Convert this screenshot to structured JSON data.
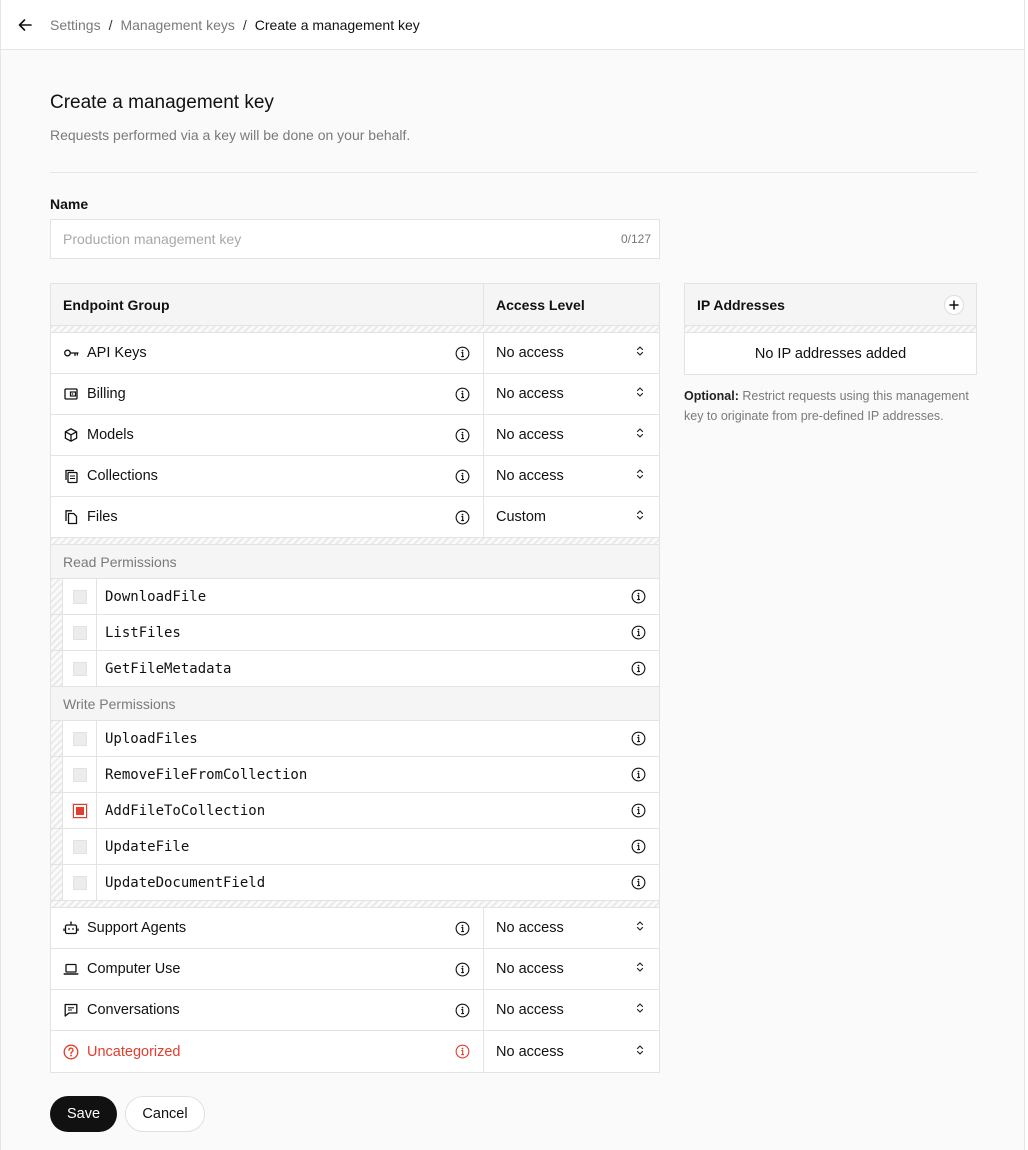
{
  "breadcrumb": {
    "items": [
      "Settings",
      "Management keys",
      "Create a management key"
    ],
    "separator": "/"
  },
  "page": {
    "title": "Create a management key",
    "subtitle": "Requests performed via a key will be done on your behalf."
  },
  "name_field": {
    "label": "Name",
    "placeholder": "Production management key",
    "value": "",
    "counter": "0/127"
  },
  "table": {
    "col_group": "Endpoint Group",
    "col_access": "Access Level",
    "groups_top": [
      {
        "icon": "key-icon",
        "label": "API Keys",
        "access": "No access"
      },
      {
        "icon": "wallet-icon",
        "label": "Billing",
        "access": "No access"
      },
      {
        "icon": "cube-icon",
        "label": "Models",
        "access": "No access"
      },
      {
        "icon": "collections-icon",
        "label": "Collections",
        "access": "No access"
      },
      {
        "icon": "files-icon",
        "label": "Files",
        "access": "Custom"
      }
    ],
    "read_title": "Read Permissions",
    "read": [
      {
        "label": "DownloadFile",
        "checked": false
      },
      {
        "label": "ListFiles",
        "checked": false
      },
      {
        "label": "GetFileMetadata",
        "checked": false
      }
    ],
    "write_title": "Write Permissions",
    "write": [
      {
        "label": "UploadFiles",
        "checked": false
      },
      {
        "label": "RemoveFileFromCollection",
        "checked": false
      },
      {
        "label": "AddFileToCollection",
        "checked": true
      },
      {
        "label": "UpdateFile",
        "checked": false
      },
      {
        "label": "UpdateDocumentField",
        "checked": false
      }
    ],
    "groups_bottom": [
      {
        "icon": "robot-icon",
        "label": "Support Agents",
        "access": "No access"
      },
      {
        "icon": "laptop-icon",
        "label": "Computer Use",
        "access": "No access"
      },
      {
        "icon": "chat-icon",
        "label": "Conversations",
        "access": "No access"
      },
      {
        "icon": "question-icon",
        "label": "Uncategorized",
        "access": "No access",
        "danger": true
      }
    ]
  },
  "ip": {
    "title": "IP Addresses",
    "empty": "No IP addresses added",
    "note_bold": "Optional:",
    "note": "Restrict requests using this management key to originate from pre-defined IP addresses."
  },
  "actions": {
    "save": "Save",
    "cancel": "Cancel"
  },
  "colors": {
    "accent_red": "#e23d2d",
    "primary_button": "#111111"
  }
}
